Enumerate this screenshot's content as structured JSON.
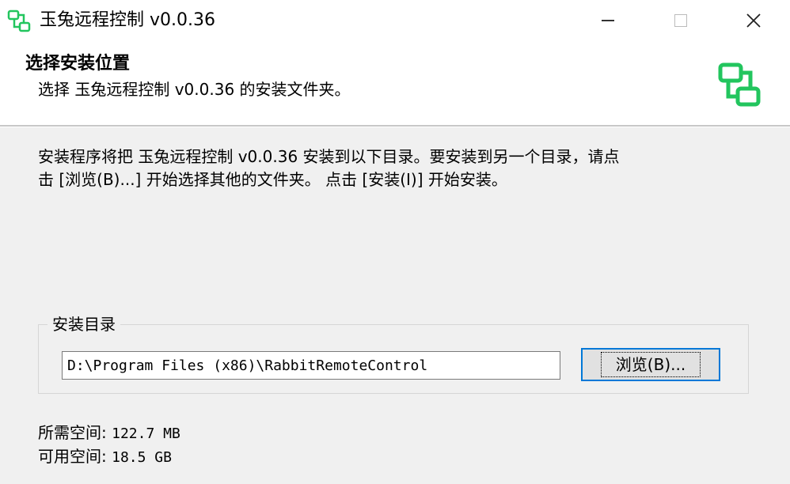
{
  "window": {
    "title": "玉兔远程控制 v0.0.36",
    "icon": "network-monitors-icon",
    "controls": {
      "minimize": "minimize-icon",
      "maximize": "maximize-icon",
      "close": "close-icon",
      "close_glyph": "✕"
    }
  },
  "header": {
    "title": "选择安装位置",
    "subtitle": "选择 玉兔远程控制 v0.0.36 的安装文件夹。",
    "logo": "network-monitors-icon",
    "accent_color": "#22c55e"
  },
  "description": {
    "line1": "安装程序将把 玉兔远程控制 v0.0.36 安装到以下目录。要安装到另一个目录，请点",
    "line2": "击 [浏览(B)...] 开始选择其他的文件夹。 点击 [安装(I)] 开始安装。"
  },
  "install_dir": {
    "group_label": "安装目录",
    "path": "D:\\Program Files (x86)\\RabbitRemoteControl",
    "browse_label": "浏览(B)..."
  },
  "space": {
    "required_label": "所需空间:",
    "required_value": "122.7 MB",
    "available_label": "可用空间:",
    "available_value": "18.5 GB"
  }
}
